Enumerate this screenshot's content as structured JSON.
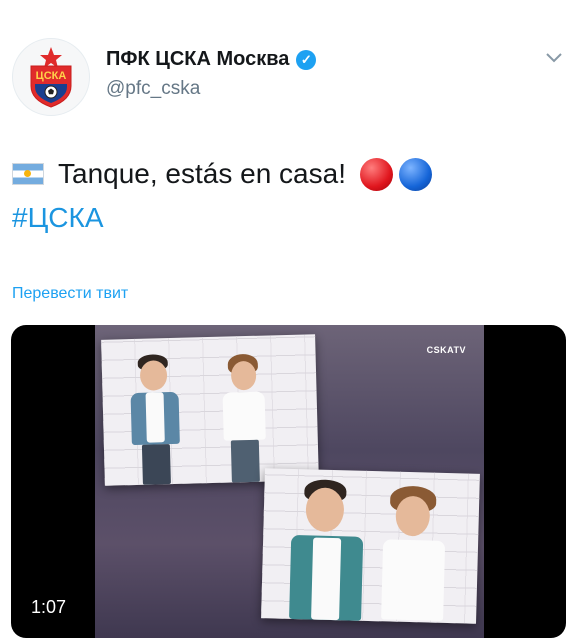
{
  "account": {
    "display_name": "ПФК ЦСКА Москва",
    "handle": "@pfc_cska",
    "verified_icon": "verified-badge-icon",
    "avatar_text": "ЦСКА"
  },
  "menu_icon": "chevron-down-icon",
  "tweet": {
    "flag_icon": "argentina-flag-icon",
    "text": "Tanque, estás en casa!",
    "emoji_icons": [
      "red-circle-icon",
      "blue-circle-icon"
    ],
    "hashtag": "#ЦСКА"
  },
  "translate_link": "Перевести твит",
  "video": {
    "duration": "1:07",
    "watermark": "CSKATV"
  },
  "colors": {
    "link": "#1da1f2",
    "hashtag": "#1b95e0",
    "verified": "#1da1f2"
  }
}
